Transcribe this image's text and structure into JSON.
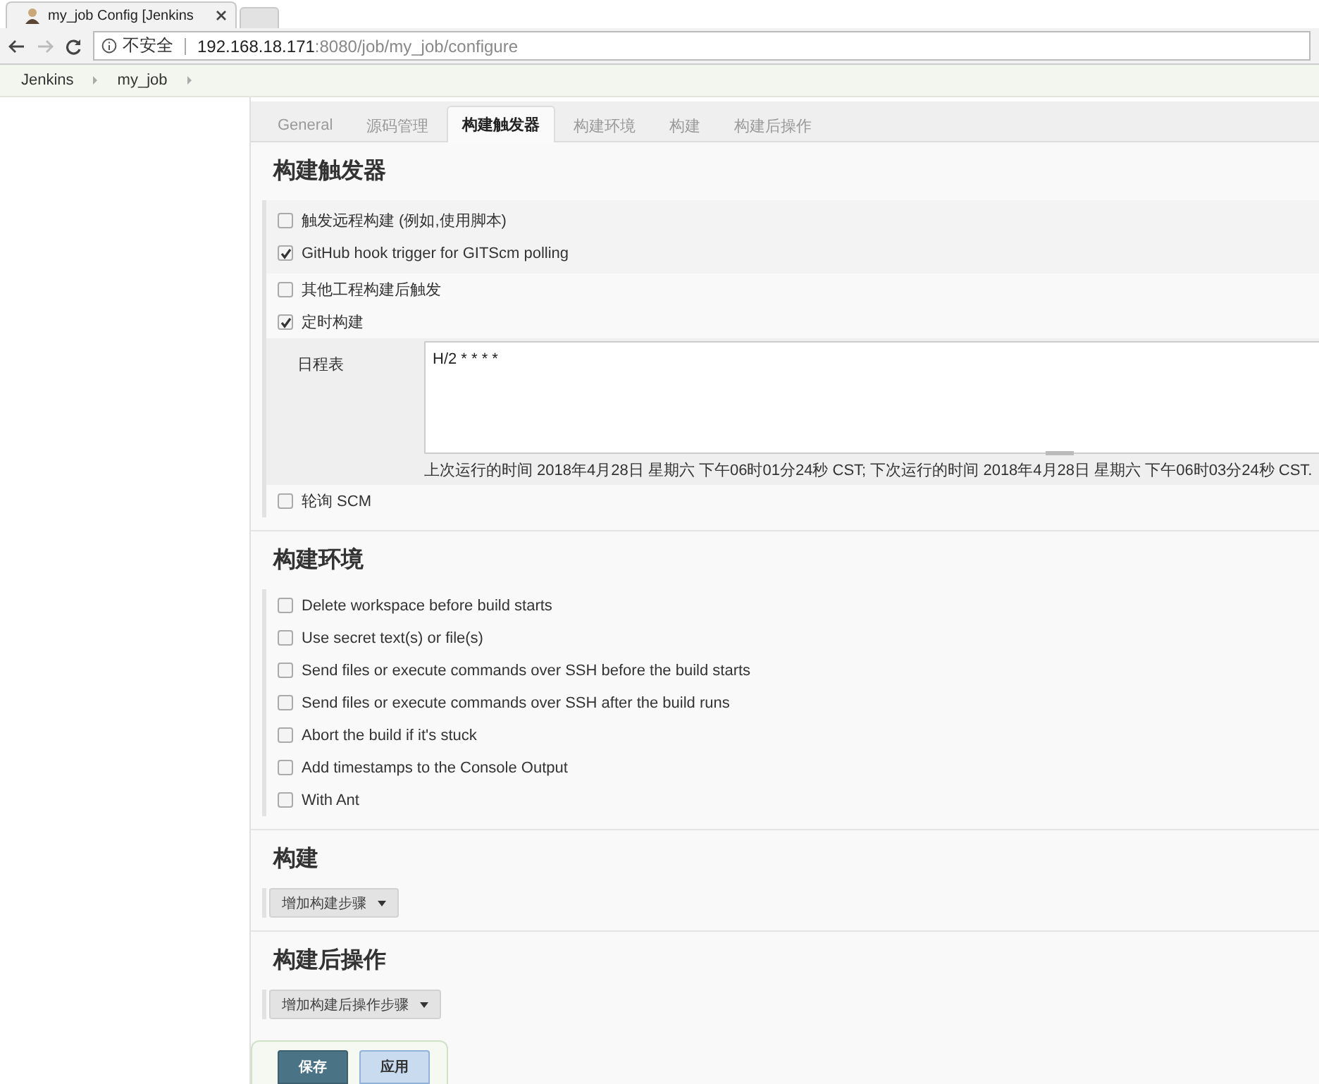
{
  "browser": {
    "tab_title": "my_job Config [Jenkins",
    "security": "不安全",
    "url_host": "192.168.18.171",
    "url_rest": ":8080/job/my_job/configure"
  },
  "breadcrumbs": [
    "Jenkins",
    "my_job"
  ],
  "tabs": [
    {
      "label": "General",
      "selected": false
    },
    {
      "label": "源码管理",
      "selected": false
    },
    {
      "label": "构建触发器",
      "selected": true
    },
    {
      "label": "构建环境",
      "selected": false
    },
    {
      "label": "构建",
      "selected": false
    },
    {
      "label": "构建后操作",
      "selected": false
    }
  ],
  "sections": [
    {
      "title": "构建触发器",
      "kind": "checkboxes",
      "options": [
        {
          "label": "触发远程构建 (例如,使用脚本)",
          "checked": false
        },
        {
          "label": "GitHub hook trigger for GITScm polling",
          "checked": true
        },
        {
          "label": "其他工程构建后触发",
          "checked": false
        },
        {
          "label": "定时构建",
          "checked": true,
          "schedule": {
            "label": "日程表",
            "value": "H/2 * * * *",
            "note": "上次运行的时间 2018年4月28日 星期六 下午06时01分24秒 CST; 下次运行的时间 2018年4月28日 星期六 下午06时03分24秒 CST."
          }
        },
        {
          "label": "轮询 SCM",
          "checked": false
        }
      ]
    },
    {
      "title": "构建环境",
      "kind": "checkboxes",
      "options": [
        {
          "label": "Delete workspace before build starts",
          "checked": false
        },
        {
          "label": "Use secret text(s) or file(s)",
          "checked": false
        },
        {
          "label": "Send files or execute commands over SSH before the build starts",
          "checked": false
        },
        {
          "label": "Send files or execute commands over SSH after the build runs",
          "checked": false
        },
        {
          "label": "Abort the build if it's stuck",
          "checked": false
        },
        {
          "label": "Add timestamps to the Console Output",
          "checked": false
        },
        {
          "label": "With Ant",
          "checked": false
        }
      ]
    },
    {
      "title": "构建",
      "kind": "dropdown",
      "button": "增加构建步骤"
    },
    {
      "title": "构建后操作",
      "kind": "dropdown",
      "button": "增加构建后操作步骤"
    }
  ],
  "bottom_bar": {
    "buttons": [
      {
        "label": "保存",
        "kind": "primary"
      },
      {
        "label": "应用",
        "kind": "secondary"
      }
    ]
  }
}
